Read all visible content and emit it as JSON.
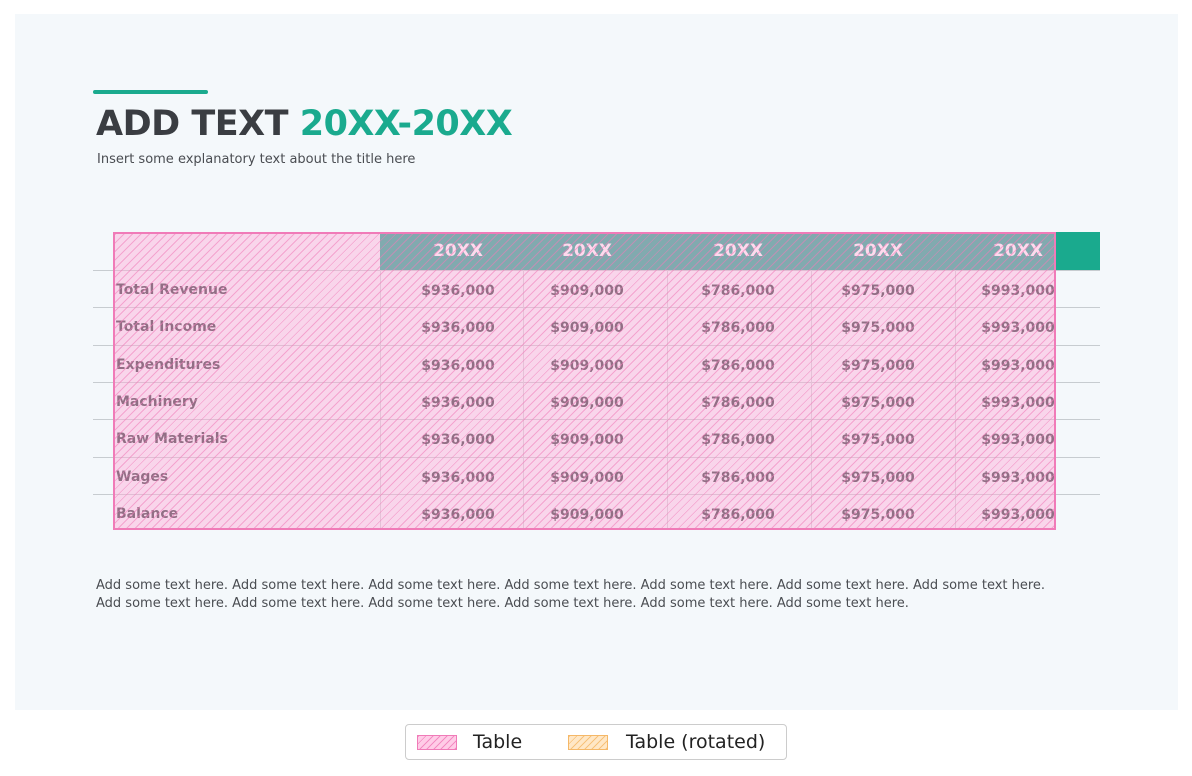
{
  "title": {
    "part1": "ADD TEXT",
    "part2": "20XX-20XX"
  },
  "subtitle": "Insert some explanatory text about the title here",
  "table": {
    "columns": [
      "20XX",
      "20XX",
      "20XX",
      "20XX",
      "20XX"
    ],
    "rows": [
      {
        "label": "Total Revenue",
        "values": [
          "$936,000",
          "$909,000",
          "$786,000",
          "$975,000",
          "$993,000"
        ]
      },
      {
        "label": "Total Income",
        "values": [
          "$936,000",
          "$909,000",
          "$786,000",
          "$975,000",
          "$993,000"
        ]
      },
      {
        "label": "Expenditures",
        "values": [
          "$936,000",
          "$909,000",
          "$786,000",
          "$975,000",
          "$993,000"
        ]
      },
      {
        "label": "Machinery",
        "values": [
          "$936,000",
          "$909,000",
          "$786,000",
          "$975,000",
          "$993,000"
        ]
      },
      {
        "label": "Raw Materials",
        "values": [
          "$936,000",
          "$909,000",
          "$786,000",
          "$975,000",
          "$993,000"
        ]
      },
      {
        "label": "Wages",
        "values": [
          "$936,000",
          "$909,000",
          "$786,000",
          "$975,000",
          "$993,000"
        ]
      },
      {
        "label": "Balance",
        "values": [
          "$936,000",
          "$909,000",
          "$786,000",
          "$975,000",
          "$993,000"
        ]
      }
    ]
  },
  "body": {
    "line1": "Add some text here. Add some text here. Add some text here. Add some text here. Add some text here. Add some text here. Add some text here.",
    "line2": "Add some text here.  Add some text here.  Add some text here.  Add some text here.  Add some text here.  Add some text here."
  },
  "legend": {
    "item1": "Table",
    "item2": "Table (rotated)"
  },
  "colors": {
    "accent": "#1aaa8e",
    "title_dark": "#3a3d42",
    "overlay_pink": "#f07bb8",
    "overlay_orange": "#f5b868"
  }
}
